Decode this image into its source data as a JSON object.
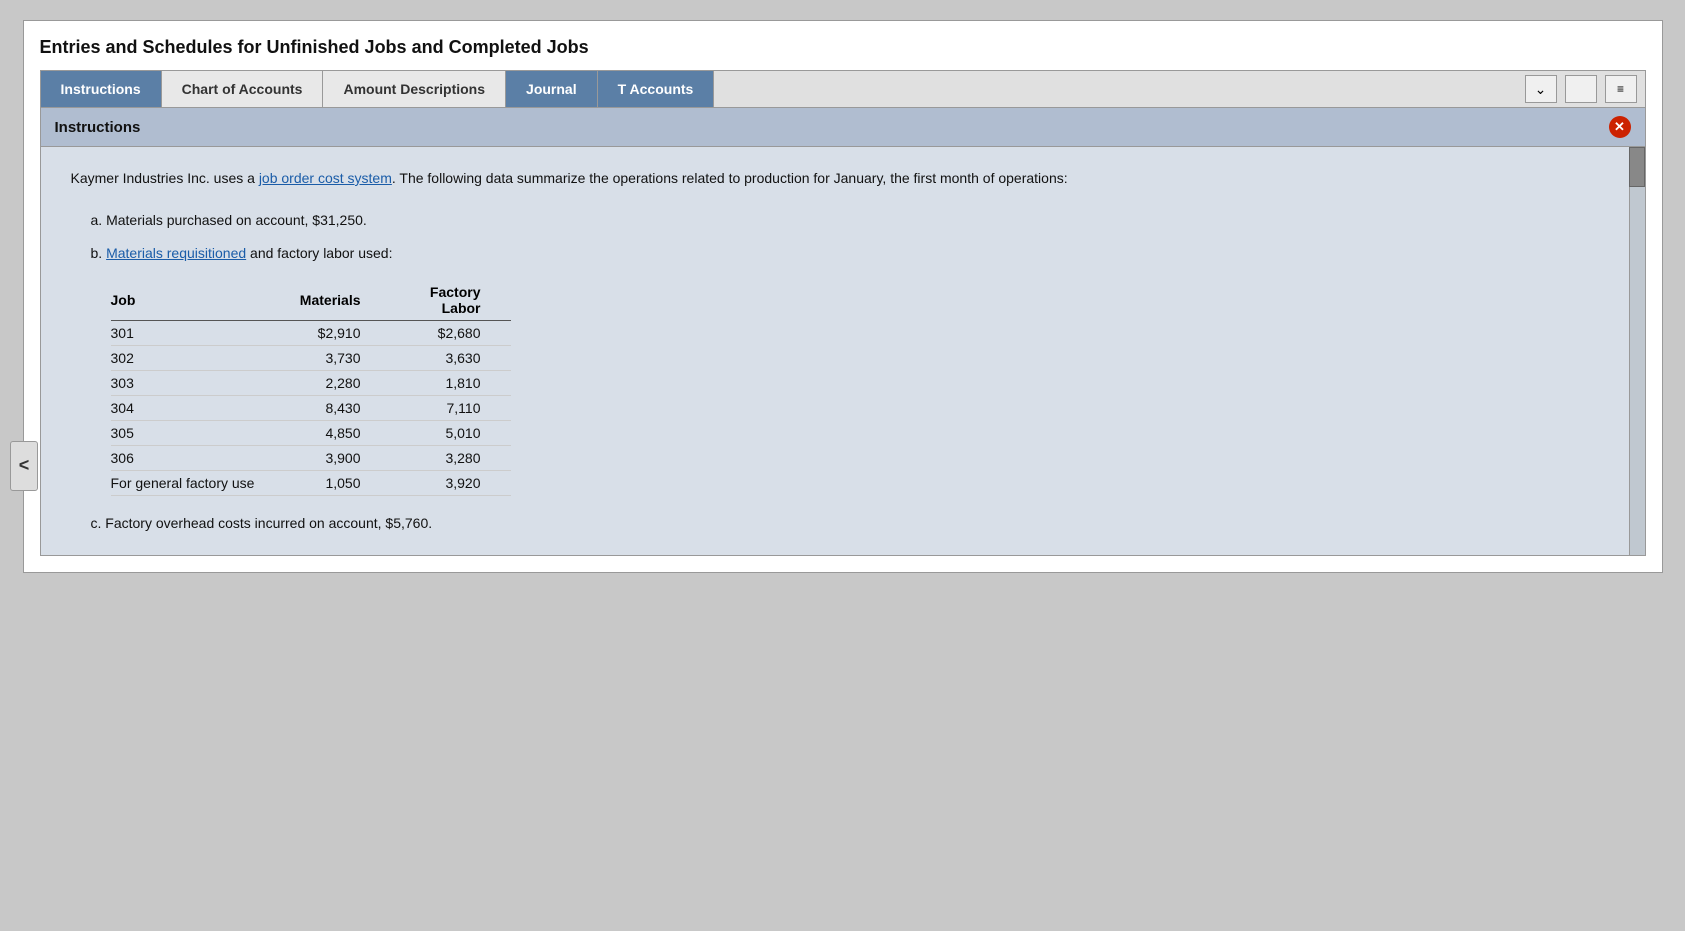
{
  "page": {
    "title": "Entries and Schedules for Unfinished Jobs and Completed Jobs"
  },
  "tabs": [
    {
      "id": "instructions",
      "label": "Instructions",
      "active": true
    },
    {
      "id": "chart-of-accounts",
      "label": "Chart of Accounts",
      "active": false
    },
    {
      "id": "amount-descriptions",
      "label": "Amount Descriptions",
      "active": false
    },
    {
      "id": "journal",
      "label": "Journal",
      "active": false
    },
    {
      "id": "t-accounts",
      "label": "T Accounts",
      "active": false
    }
  ],
  "controls": {
    "dropdown_icon": "⌄",
    "menu_icon": "≡"
  },
  "section": {
    "header": "Instructions",
    "close_label": "✕"
  },
  "content": {
    "intro": "Kaymer Industries Inc. uses a job order cost system. The following data summarize the operations related to production for January, the first month of operations:",
    "intro_link": "job order cost system",
    "item_a": "a. Materials purchased on account, $31,250.",
    "item_b_prefix": "b. ",
    "item_b_link": "Materials requisitioned",
    "item_b_suffix": " and factory labor used:",
    "table": {
      "headers": [
        "Job",
        "Materials",
        "Factory Labor"
      ],
      "rows": [
        {
          "job": "301",
          "materials": "$2,910",
          "labor": "$2,680"
        },
        {
          "job": "302",
          "materials": "3,730",
          "labor": "3,630"
        },
        {
          "job": "303",
          "materials": "2,280",
          "labor": "1,810"
        },
        {
          "job": "304",
          "materials": "8,430",
          "labor": "7,110"
        },
        {
          "job": "305",
          "materials": "4,850",
          "labor": "5,010"
        },
        {
          "job": "306",
          "materials": "3,900",
          "labor": "3,280"
        },
        {
          "job": "For general factory use",
          "materials": "1,050",
          "labor": "3,920"
        }
      ]
    },
    "item_c": "c. Factory overhead costs incurred on account, $5,760."
  }
}
